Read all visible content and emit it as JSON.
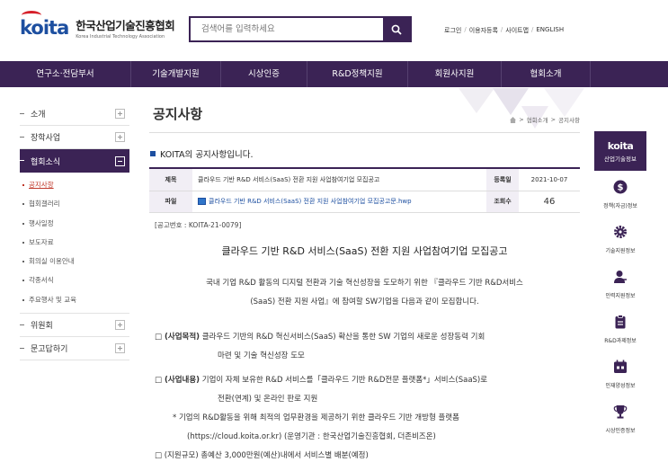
{
  "header": {
    "logo_mark": "koita",
    "logo_kr": "한국산업기술진흥협회",
    "logo_en": "Korea Industrial Technology Association",
    "search_placeholder": "검색어를 입력하세요",
    "util": [
      "로그인",
      "이용자등록",
      "사이트맵",
      "ENGLISH"
    ]
  },
  "gnb": [
    "연구소·전담부서",
    "기술개발지원",
    "시상인증",
    "R&D정책지원",
    "회원사지원",
    "협회소개"
  ],
  "sidebar": {
    "items": [
      {
        "label": "소개",
        "state": "plus"
      },
      {
        "label": "장학사업",
        "state": "plus"
      },
      {
        "label": "협회소식",
        "state": "minus"
      },
      {
        "label": "위원회",
        "state": "plus"
      },
      {
        "label": "문고답하기",
        "state": "plus"
      }
    ],
    "sub": [
      "공지사항",
      "협회갤러리",
      "행사일정",
      "보도자료",
      "회의실 이용안내",
      "각종서식",
      "주요행사 및 교육"
    ]
  },
  "page": {
    "title": "공지사항",
    "breadcrumb": [
      "협회소개",
      "공지사항"
    ],
    "intro": "KOITA의 공지사항입니다."
  },
  "board": {
    "subject_label": "제목",
    "subject": "클라우드 기반 R&D 서비스(SaaS) 전환 지원 사업참여기업 모집공고",
    "date_label": "등록일",
    "date": "2021-10-07",
    "file_label": "파일",
    "file": "클라우드 기반 R&D 서비스(SaaS) 전환 지원 사업참여기업 모집공고문.hwp",
    "views_label": "조회수",
    "views": "46"
  },
  "content": {
    "number": "[공고번호 : KOITA-21-0079]",
    "title": "클라우드 기반 R&D 서비스(SaaS) 전환 지원 사업참여기업 모집공고",
    "p1": "국내 기업 R&D 활동의 디지털 전환과 기술 혁신성장을 도모하기 위한 『클라우드 기반 R&D서비스",
    "p2": "(SaaS) 전환 지원 사업』에 참여할 SW기업을 다음과 같이 모집합니다.",
    "i1_head": "□ (사업목적)",
    "i1": " 클라우드 기반의 R&D 혁신서비스(SaaS) 확산을 통한 SW 기업의 새로운 성장동력 기회",
    "i1b": "마련 및 기술 혁신성장 도모",
    "i2_head": "□ (사업내용)",
    "i2": " 기업이 자체 보유한 R&D 서비스를「클라우드 기반 R&D전문 플랫폼*」서비스(SaaS)로",
    "i2b": "전환(연계) 및 온라인 판로 지원",
    "i2c": "* 기업의 R&D활동을 위해 최적의 업무환경을 제공하기 위한 클라우드 기반 개방형 플랫폼",
    "i2d": "(https://cloud.koita.or.kr) (운영기관 : 한국산업기술진흥협회, 더존비즈온)",
    "i3": "□ (지원규모) 총예산 3,000만원(예산)내에서 서비스별 배분(예정)"
  },
  "quick": {
    "head_k": "koita",
    "head_t": "산업기술정보",
    "items": [
      {
        "label": "정책(자금)정보",
        "icon": "dollar-icon"
      },
      {
        "label": "기술지원정보",
        "icon": "gear-icon"
      },
      {
        "label": "인력지원정보",
        "icon": "person-icon"
      },
      {
        "label": "R&D과제정보",
        "icon": "clipboard-icon"
      },
      {
        "label": "인재양성정보",
        "icon": "calendar-icon"
      },
      {
        "label": "시상인증정보",
        "icon": "trophy-icon"
      }
    ]
  },
  "colors": {
    "primary": "#3b2355",
    "brand_blue": "#1d4fa0",
    "accent_red": "#c0392b"
  }
}
